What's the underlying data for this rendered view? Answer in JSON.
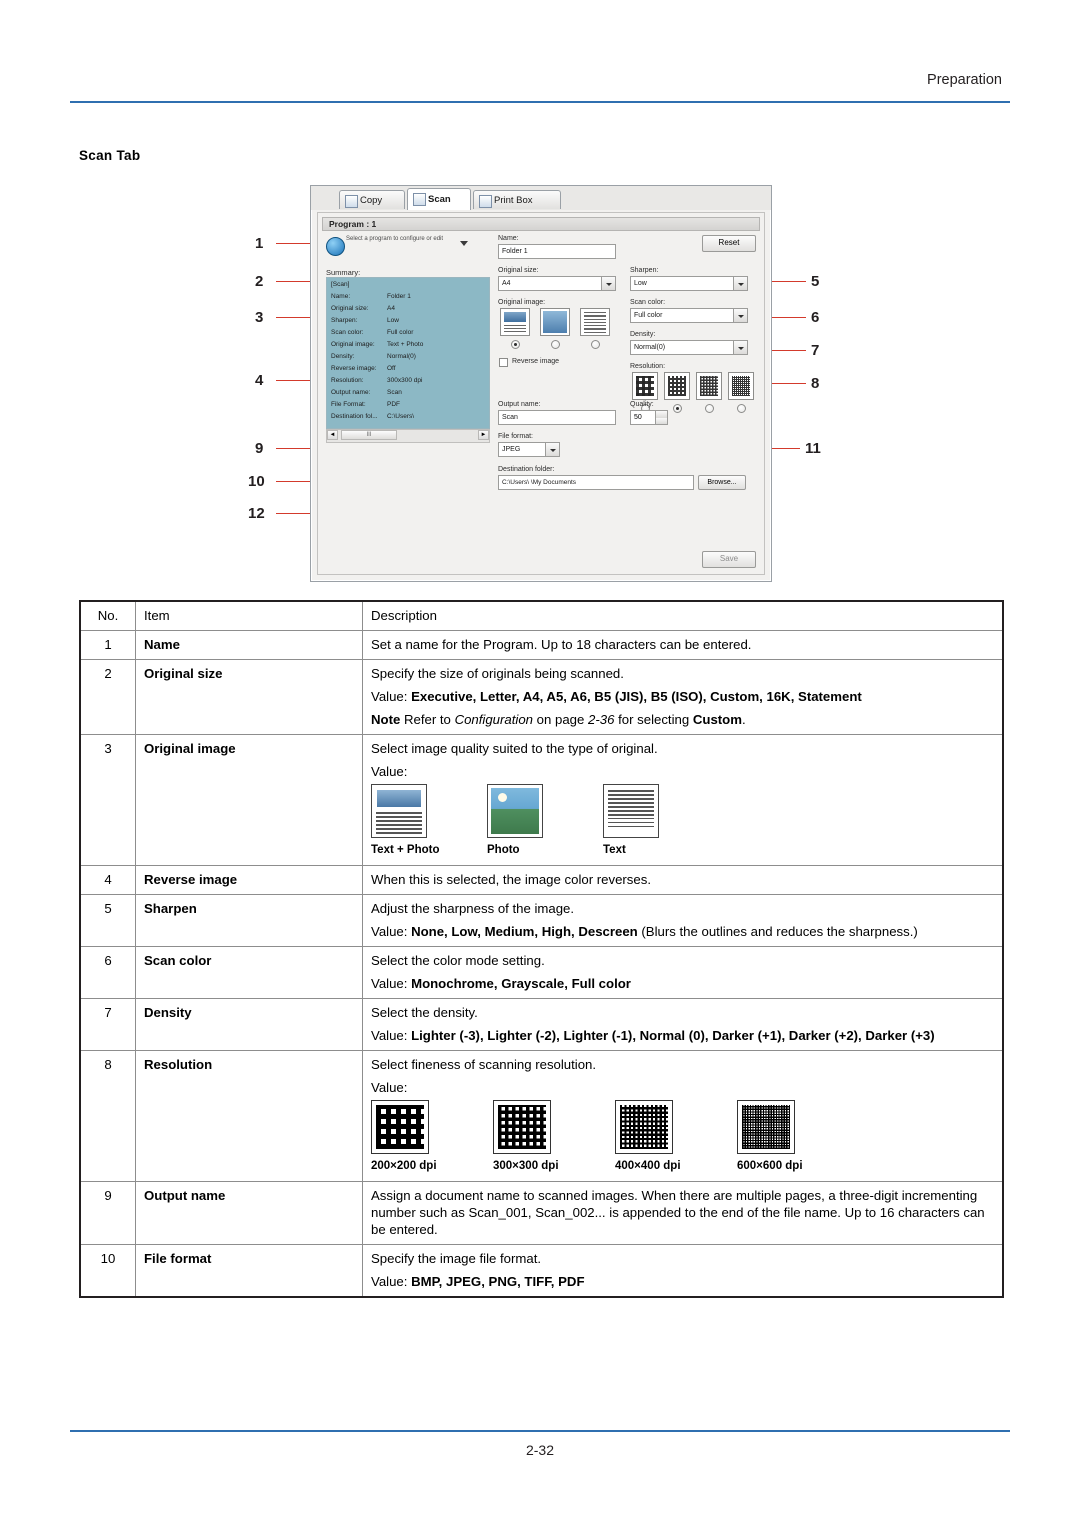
{
  "header": {
    "title": "Preparation"
  },
  "section": {
    "title": "Scan Tab"
  },
  "footer": {
    "page": "2-32"
  },
  "screenshot": {
    "tabs": [
      {
        "label": "Copy",
        "active": false
      },
      {
        "label": "Scan",
        "active": true
      },
      {
        "label": "Print Box",
        "active": false
      }
    ],
    "program_bar": "Program : 1",
    "reset_button": "Reset",
    "save_button": "Save",
    "program_hint": "Select a program to configure or edit",
    "summary_label": "Summary:",
    "summary_rows": [
      {
        "key": "[Scan]",
        "value": ""
      },
      {
        "key": "Name:",
        "value": "Folder 1"
      },
      {
        "key": "Original size:",
        "value": "A4"
      },
      {
        "key": "Sharpen:",
        "value": "Low"
      },
      {
        "key": "Scan color:",
        "value": "Full color"
      },
      {
        "key": "Original image:",
        "value": "Text + Photo"
      },
      {
        "key": "Density:",
        "value": "Normal(0)"
      },
      {
        "key": "Reverse image:",
        "value": "Off"
      },
      {
        "key": "Resolution:",
        "value": "300x300 dpi"
      },
      {
        "key": "Output name:",
        "value": "Scan"
      },
      {
        "key": "File Format:",
        "value": "PDF"
      },
      {
        "key": "Destination fol...",
        "value": "C:\\Users\\"
      }
    ],
    "scroll_thumb": "III",
    "fields": {
      "name_label": "Name:",
      "name_value": "Folder 1",
      "original_size_label": "Original size:",
      "original_size_value": "A4",
      "original_image_label": "Original image:",
      "reverse_image_label": "Reverse image",
      "output_name_label": "Output name:",
      "output_name_value": "Scan",
      "file_format_label": "File format:",
      "file_format_value": "JPEG",
      "destination_label": "Destination folder:",
      "destination_value": "C:\\Users\\              \\My Documents",
      "browse_label": "Browse...",
      "sharpen_label": "Sharpen:",
      "sharpen_value": "Low",
      "scan_color_label": "Scan color:",
      "scan_color_value": "Full color",
      "density_label": "Density:",
      "density_value": "Normal(0)",
      "resolution_label": "Resolution:",
      "quality_label": "Quality:",
      "quality_value": "50"
    },
    "callouts": [
      "1",
      "2",
      "3",
      "4",
      "9",
      "10",
      "12",
      "5",
      "6",
      "7",
      "8",
      "11"
    ]
  },
  "table": {
    "headers": {
      "no": "No.",
      "item": "Item",
      "description": "Description"
    },
    "rows": [
      {
        "no": "1",
        "item": "Name",
        "desc": "Set a name for the Program. Up to 18 characters can be entered."
      },
      {
        "no": "2",
        "item": "Original size",
        "desc": "Specify the size of originals being scanned.",
        "value_prefix": "Value: ",
        "value_bold": "Executive, Letter, A4, A5, A6, B5 (JIS), B5 (ISO), Custom, 16K, Statement",
        "note_label": "Note",
        "note_text_1": "Refer to ",
        "note_italic": "Configuration",
        "note_text_2": " on page ",
        "note_page": "2-36",
        "note_text_3": " for selecting ",
        "note_bold": "Custom",
        "note_end": "."
      },
      {
        "no": "3",
        "item": "Original image",
        "desc": "Select image quality suited to the type of original.",
        "value_label": "Value:",
        "samples": [
          {
            "caption": "Text + Photo",
            "kind": "text-photo"
          },
          {
            "caption": "Photo",
            "kind": "photo"
          },
          {
            "caption": "Text",
            "kind": "text"
          }
        ]
      },
      {
        "no": "4",
        "item": "Reverse image",
        "desc": "When this is selected, the image color reverses."
      },
      {
        "no": "5",
        "item": "Sharpen",
        "desc": "Adjust the sharpness of the image.",
        "value_prefix": "Value: ",
        "value_bold": "None, Low, Medium, High, Descreen",
        "value_tail": " (Blurs the outlines and reduces the sharpness.)"
      },
      {
        "no": "6",
        "item": "Scan color",
        "desc": "Select the color mode setting.",
        "value_prefix": "Value: ",
        "value_bold": "Monochrome, Grayscale, Full color"
      },
      {
        "no": "7",
        "item": "Density",
        "desc": "Select the density.",
        "value_prefix": "Value: ",
        "value_bold": "Lighter (-3), Lighter (-2), Lighter (-1), Normal (0), Darker (+1), Darker (+2), Darker (+3)"
      },
      {
        "no": "8",
        "item": "Resolution",
        "desc": "Select fineness of scanning resolution.",
        "value_label": "Value:",
        "resolutions": [
          {
            "caption": "200×200 dpi",
            "density": 1
          },
          {
            "caption": "300×300 dpi",
            "density": 2
          },
          {
            "caption": "400×400 dpi",
            "density": 3
          },
          {
            "caption": "600×600 dpi",
            "density": 4
          }
        ]
      },
      {
        "no": "9",
        "item": "Output name",
        "desc": "Assign a document name to scanned images. When there are multiple pages, a three-digit incrementing number such as Scan_001, Scan_002... is appended to the end of the file name. Up to 16 characters can be entered."
      },
      {
        "no": "10",
        "item": "File format",
        "desc": "Specify the image file format.",
        "value_prefix": "Value: ",
        "value_bold": "BMP, JPEG, PNG, TIFF, PDF"
      }
    ]
  }
}
